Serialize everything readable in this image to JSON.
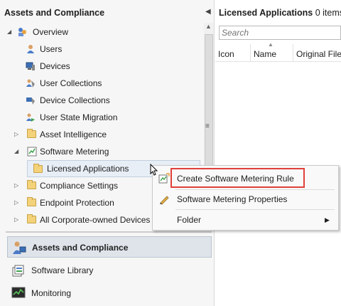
{
  "left_pane": {
    "title": "Assets and Compliance",
    "tree": [
      {
        "label": "Overview",
        "icon": "overview-icon",
        "expander": "▲"
      },
      {
        "label": "Users",
        "icon": "users-icon"
      },
      {
        "label": "Devices",
        "icon": "devices-icon"
      },
      {
        "label": "User Collections",
        "icon": "user-collections-icon"
      },
      {
        "label": "Device Collections",
        "icon": "device-collections-icon"
      },
      {
        "label": "User State Migration",
        "icon": "user-state-migration-icon"
      },
      {
        "label": "Asset Intelligence",
        "icon": "folder-icon",
        "expander": "▷"
      },
      {
        "label": "Software Metering",
        "icon": "software-metering-icon",
        "expander": "▲"
      },
      {
        "label": "Licensed Applications",
        "icon": "folder-icon"
      },
      {
        "label": "Compliance Settings",
        "icon": "folder-icon",
        "expander": "▷"
      },
      {
        "label": "Endpoint Protection",
        "icon": "folder-icon",
        "expander": "▷"
      },
      {
        "label": "All Corporate-owned Devices",
        "icon": "folder-icon",
        "expander": "▷"
      }
    ],
    "workspaces": [
      {
        "label": "Assets and Compliance",
        "icon": "assets-compliance-icon",
        "selected": true
      },
      {
        "label": "Software Library",
        "icon": "software-library-icon"
      },
      {
        "label": "Monitoring",
        "icon": "monitoring-icon"
      }
    ]
  },
  "right_pane": {
    "title": "Licensed Applications",
    "count": "0 items",
    "search": {
      "placeholder": "Search",
      "value": ""
    },
    "columns": [
      "Icon",
      "Name",
      "Original File"
    ]
  },
  "context_menu": {
    "items": [
      {
        "label": "Create Software Metering Rule",
        "icon": "create-rule-icon",
        "highlighted": true
      },
      {
        "label": "Software Metering Properties",
        "icon": "pencil-icon"
      },
      {
        "label": "Folder",
        "submenu": true
      }
    ],
    "highlight_color": "#e0403a"
  }
}
